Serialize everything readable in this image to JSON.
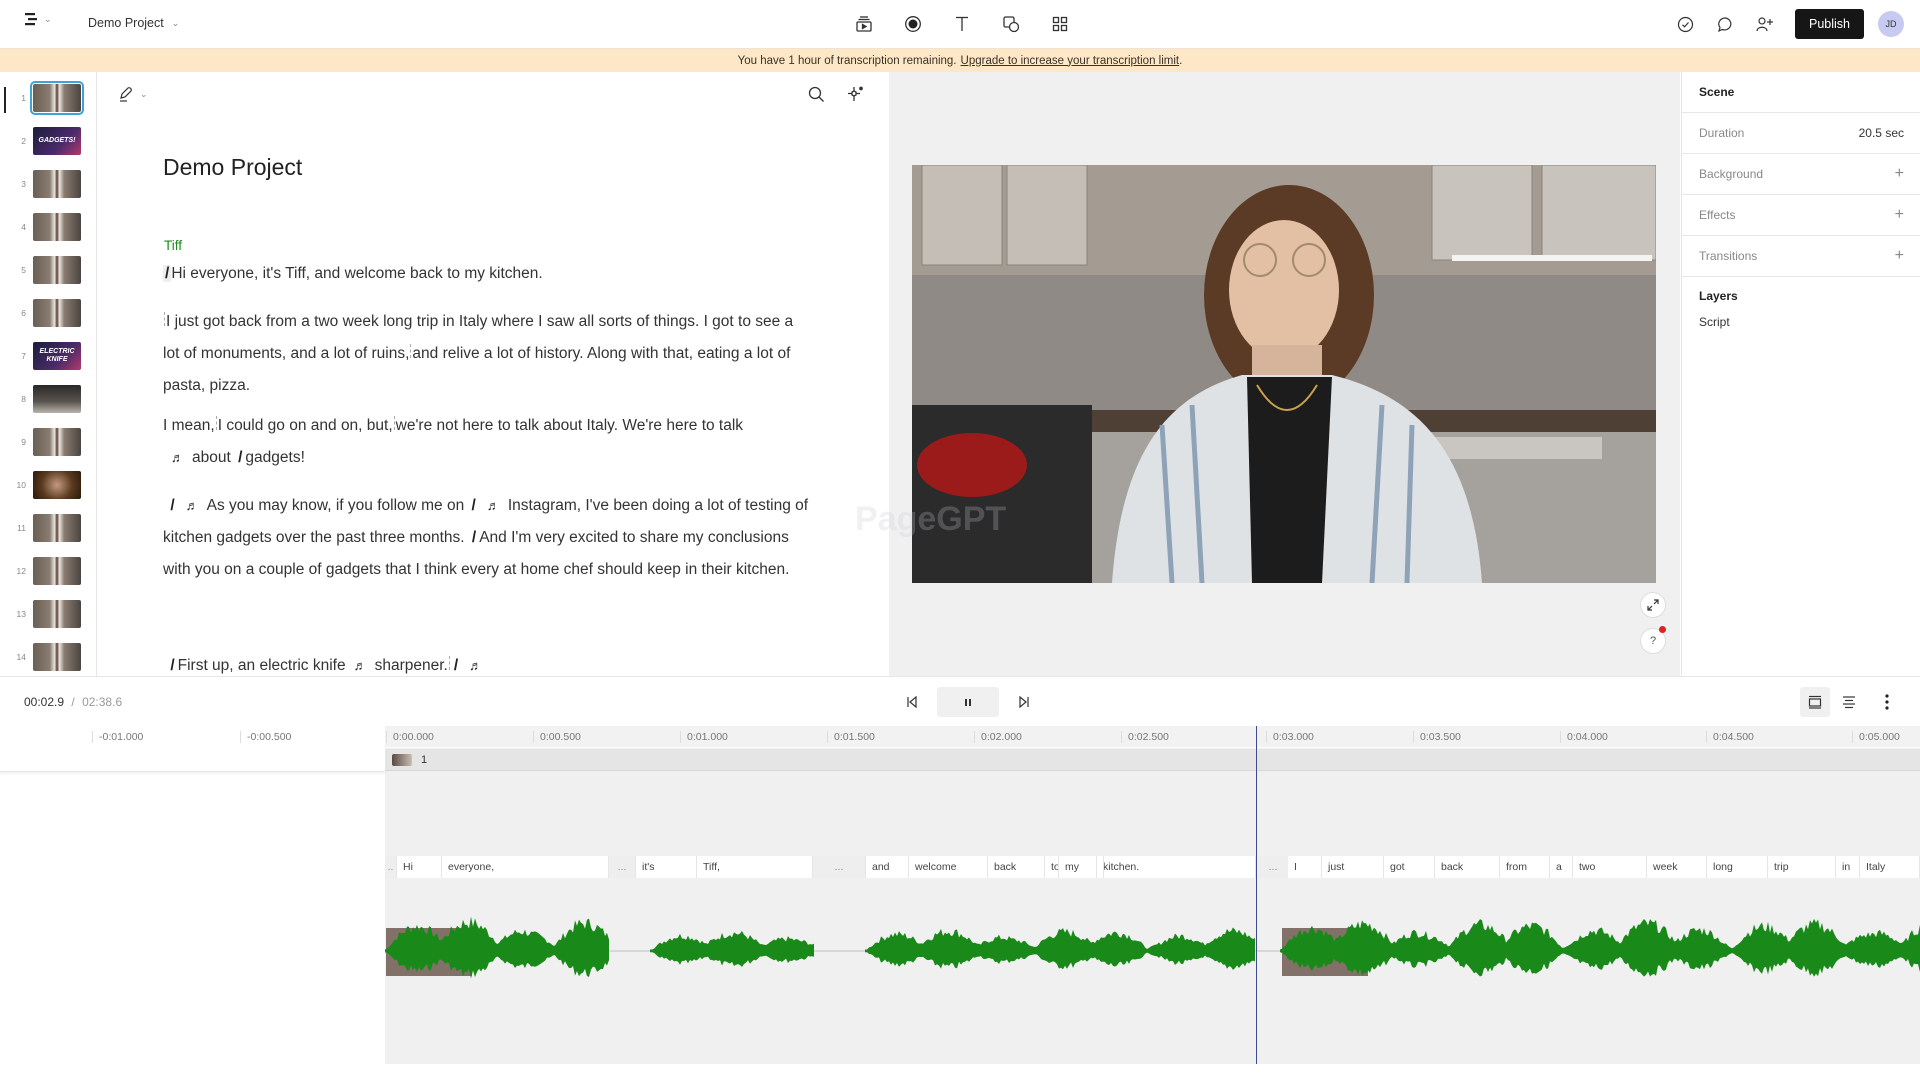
{
  "header": {
    "project_name": "Demo Project",
    "publish_label": "Publish",
    "avatar_initials": "JD",
    "tools": [
      "scenes-icon",
      "record-icon",
      "text-icon",
      "shapes-icon",
      "grid-icon"
    ],
    "right_icons": [
      "check-circle-icon",
      "comment-icon",
      "add-user-icon"
    ]
  },
  "banner": {
    "text": "You have 1 hour of transcription remaining.",
    "link": "Upgrade to increase your transcription limit",
    "suffix": "."
  },
  "scenes": [
    {
      "num": "1",
      "kind": "person",
      "active": true
    },
    {
      "num": "2",
      "kind": "title",
      "label": "GADGETS!"
    },
    {
      "num": "3",
      "kind": "person"
    },
    {
      "num": "4",
      "kind": "person"
    },
    {
      "num": "5",
      "kind": "person"
    },
    {
      "num": "6",
      "kind": "person"
    },
    {
      "num": "7",
      "kind": "title",
      "label": "ELECTRIC KNIFE"
    },
    {
      "num": "8",
      "kind": "dark"
    },
    {
      "num": "9",
      "kind": "person"
    },
    {
      "num": "10",
      "kind": "warm"
    },
    {
      "num": "11",
      "kind": "person"
    },
    {
      "num": "12",
      "kind": "person"
    },
    {
      "num": "13",
      "kind": "person"
    },
    {
      "num": "14",
      "kind": "person"
    }
  ],
  "editor": {
    "title": "Demo Project",
    "speaker": "Tiff",
    "paragraphs": {
      "p1": "Hi everyone, it's Tiff, and welcome back to my kitchen.",
      "p2a": "I just got back from a two week long trip in Italy where I saw all sorts of things. I got to see a lot of monuments, and a lot of ruins,",
      "p2b": "and relive a lot of history. Along with that, eating a lot of pasta, pizza.",
      "p3a": "I mean,",
      "p3b": "I could go on and on, but,",
      "p3c": "we're not here to talk about Italy. We're here to talk",
      "p3d": "about",
      "p3e": "gadgets!",
      "p4a": "As you may know, if you follow me on",
      "p4b": "Instagram, I've been doing a lot of testing of kitchen gadgets over the past three months.",
      "p4c": "And I'm very excited to share my conclusions with you on a couple of gadgets that I think every at home chef should keep in their kitchen.",
      "p5a": "First up, an electric knife",
      "p5b": "sharpener."
    },
    "scene_marker": "/",
    "music_marker": "♬"
  },
  "properties": {
    "scene_heading": "Scene",
    "duration_label": "Duration",
    "duration_value": "20.5 sec",
    "background_label": "Background",
    "effects_label": "Effects",
    "transitions_label": "Transitions",
    "layers_heading": "Layers",
    "layers": [
      "Script"
    ]
  },
  "transport": {
    "current_time": "00:02.9",
    "separator": "/",
    "total_time": "02:38.6"
  },
  "timeline": {
    "ticks": [
      "-0:01.000",
      "-0:00.500",
      "0:00.000",
      "0:00.500",
      "0:01.000",
      "0:01.500",
      "0:02.000",
      "0:02.500",
      "0:03.000",
      "0:03.500",
      "0:04.000",
      "0:04.500",
      "0:05.000"
    ],
    "scene_label": "1",
    "playhead_time": "0:02.9",
    "words": [
      "..",
      "Hi",
      "everyone,",
      "...",
      "it's",
      "Tiff,",
      "...",
      "and",
      "welcome",
      "back",
      "to",
      "my",
      "kitchen.",
      "...",
      "I",
      "just",
      "got",
      "back",
      "from",
      "a",
      "two",
      "week",
      "long",
      "trip",
      "in",
      "Italy"
    ],
    "waveform_color": "#198a19"
  }
}
